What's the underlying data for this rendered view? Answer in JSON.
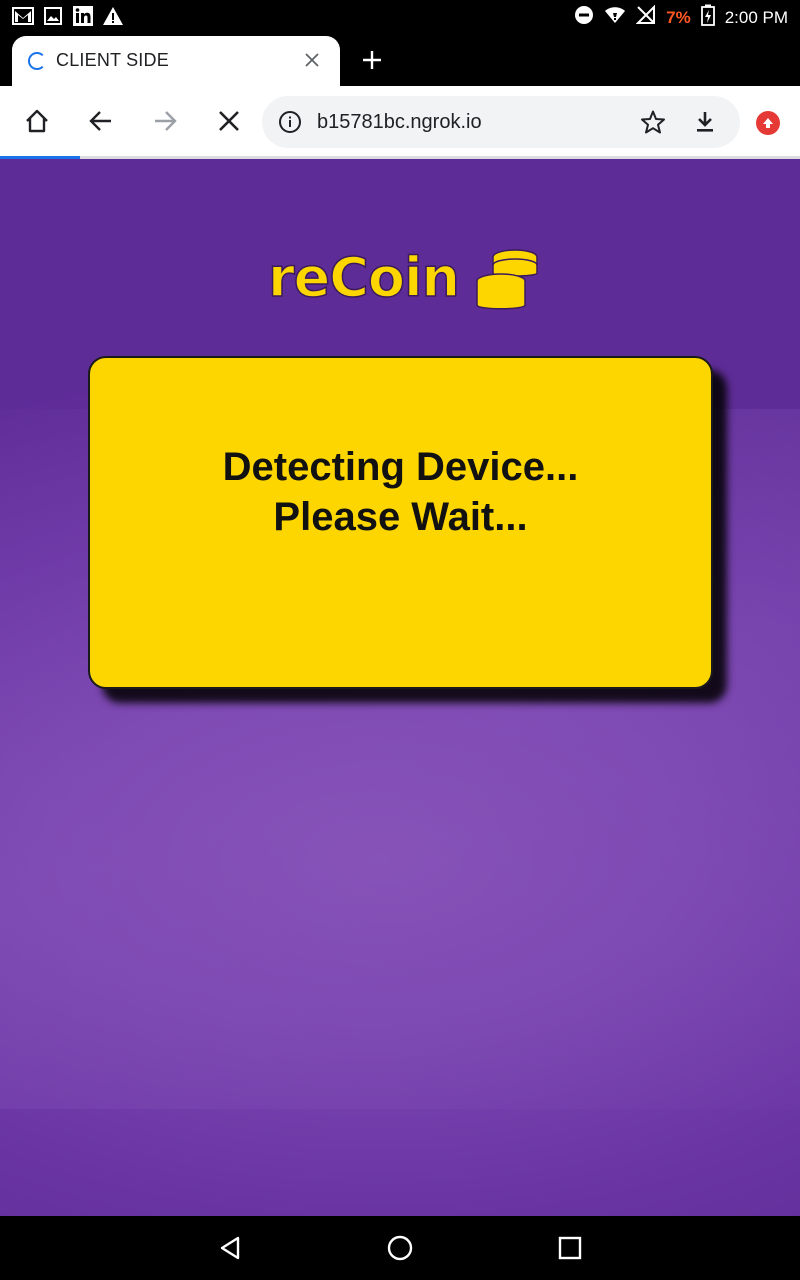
{
  "status_bar": {
    "battery_percent": "7%",
    "time": "2:00 PM",
    "left_icons": [
      "gmail-icon",
      "gallery-icon",
      "linkedin-icon",
      "warning-icon"
    ],
    "right_icons": [
      "do-not-disturb-icon",
      "wifi-icon",
      "no-signal-icon",
      "battery-charging-icon"
    ]
  },
  "browser": {
    "tab_title": "CLIENT SIDE",
    "url": "b15781bc.ngrok.io",
    "loading": true,
    "load_progress": 0.1
  },
  "page": {
    "logo_text": "reCoin",
    "message_line1": "Detecting Device...",
    "message_line2": "Please Wait..."
  },
  "colors": {
    "accent_yellow": "#fdd600",
    "background_purple": "#7a45b0",
    "chrome_blue": "#1a73e8",
    "battery_low": "#ff5722"
  }
}
